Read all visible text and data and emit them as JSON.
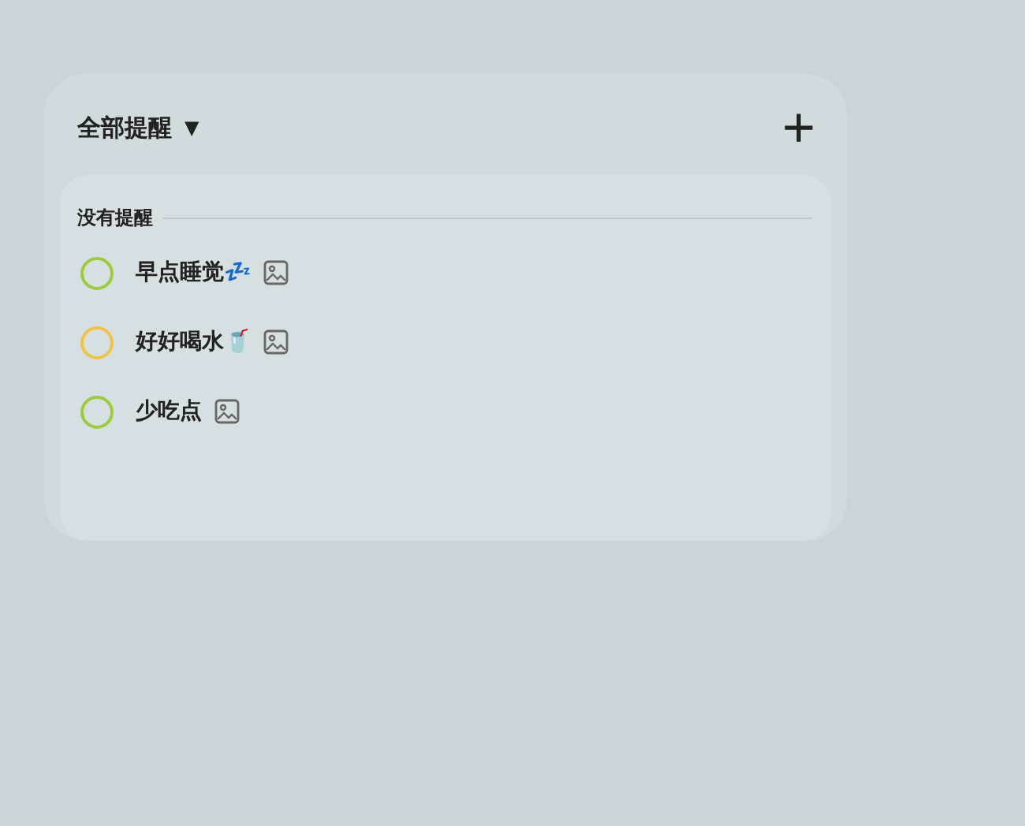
{
  "header": {
    "title": "全部提醒",
    "dropdown": "▼",
    "add_button": "+"
  },
  "section": {
    "title": "没有提醒"
  },
  "reminders": [
    {
      "text": "早点睡觉💤",
      "color": "#9ccb3f",
      "has_image": true
    },
    {
      "text": "好好喝水🥤",
      "color": "#f0c348",
      "has_image": true
    },
    {
      "text": "少吃点",
      "color": "#9ccb3f",
      "has_image": true
    }
  ]
}
